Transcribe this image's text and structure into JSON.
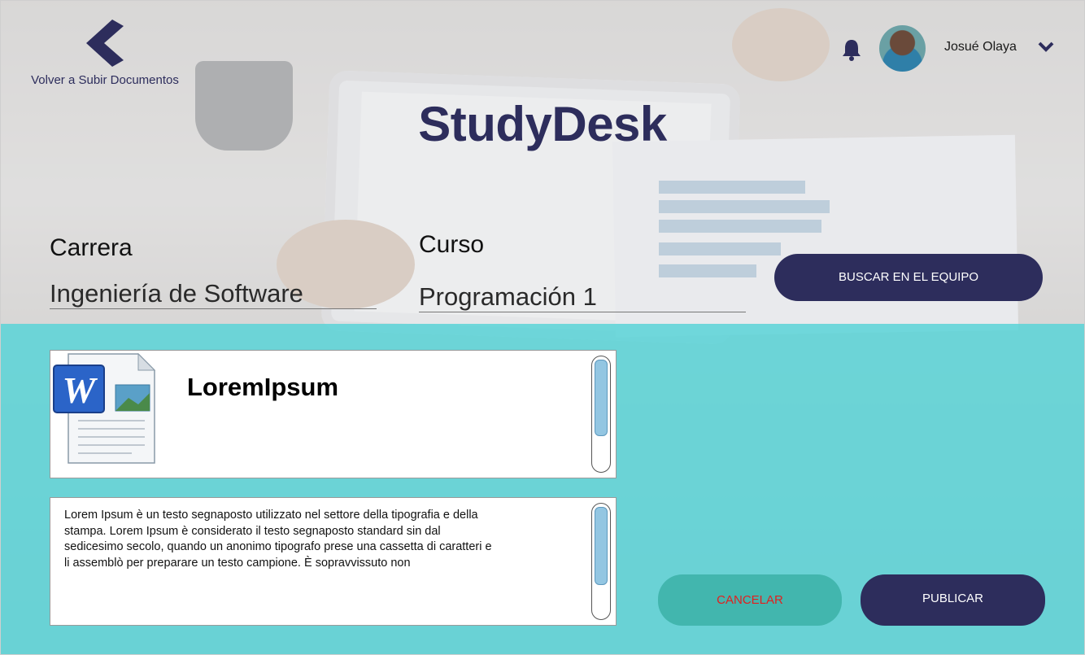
{
  "header": {
    "back_label": "Volver a Subir Documentos",
    "app_title": "StudyDesk",
    "user_name": "Josué Olaya"
  },
  "form": {
    "carrera_label": "Carrera",
    "carrera_value": "Ingeniería de Software",
    "curso_label": "Curso",
    "curso_value": "Programación 1",
    "search_button": "BUSCAR EN EL EQUIPO"
  },
  "document": {
    "title": "LoremIpsum",
    "icon": "word-document-icon",
    "description": "Lorem Ipsum è un testo segnaposto utilizzato nel settore della tipografia e della stampa. Lorem Ipsum è considerato il testo segnaposto standard sin dal sedicesimo secolo, quando un anonimo tipografo prese una cassetta di caratteri e li assemblò per preparare un testo campione. È sopravvissuto non"
  },
  "actions": {
    "cancel_label": "CANCELAR",
    "publish_label": "PUBLICAR"
  },
  "colors": {
    "primary": "#2d2d5c",
    "accent_teal": "#65d5d8",
    "cancel_button": "#42b6ae",
    "cancel_text": "#e1201f"
  }
}
